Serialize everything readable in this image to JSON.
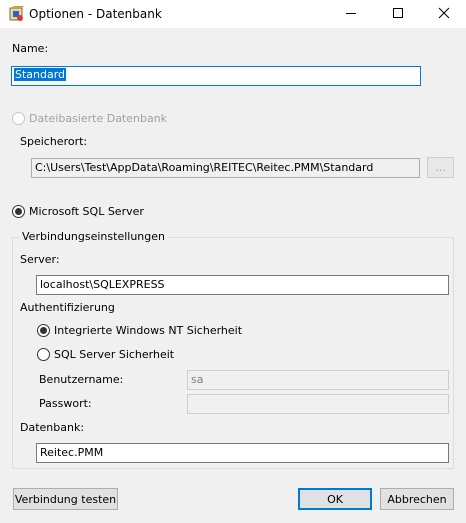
{
  "window": {
    "title": "Optionen - Datenbank",
    "icons": [
      "app-icon",
      "minimize-icon",
      "maximize-icon",
      "close-icon"
    ]
  },
  "name": {
    "label": "Name:",
    "value": "Standard"
  },
  "file_db": {
    "option_label": "Dateibasierte Datenbank",
    "selected": false,
    "enabled": false,
    "location_label": "Speicherort:",
    "location_value": "C:\\Users\\Test\\AppData\\Roaming\\REITEC\\Reitec.PMM\\Standard",
    "browse_label": "..."
  },
  "sql": {
    "option_label": "Microsoft SQL Server",
    "selected": true,
    "group_title": "Verbindungseinstellungen",
    "server_label": "Server:",
    "server_value": "localhost\\SQLEXPRESS",
    "auth_label": "Authentifizierung",
    "auth_windows_label": "Integrierte Windows NT Sicherheit",
    "auth_sql_label": "SQL Server Sicherheit",
    "auth_selected": "windows",
    "username_label": "Benutzername:",
    "username_value": "sa",
    "password_label": "Passwort:",
    "password_value": "",
    "database_label": "Datenbank:",
    "database_value": "Reitec.PMM"
  },
  "buttons": {
    "test": "Verbindung testen",
    "ok": "OK",
    "cancel": "Abbrechen"
  },
  "colors": {
    "accent": "#0078d7",
    "window_bg": "#f0f0f0",
    "disabled_text": "#a0a0a0"
  }
}
